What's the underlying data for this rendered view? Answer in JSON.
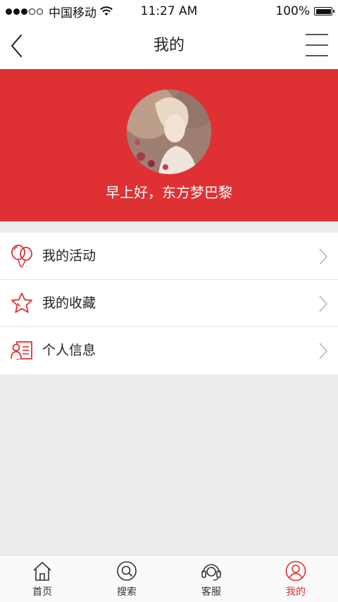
{
  "status_bar": {
    "carrier": "中国移动",
    "time": "11:27 AM",
    "battery": "100%"
  },
  "nav": {
    "title": "我的"
  },
  "profile": {
    "greeting": "早上好，东方梦巴黎"
  },
  "menu": {
    "items": [
      {
        "label": "我的活动",
        "icon": "balloon-icon"
      },
      {
        "label": "我的收藏",
        "icon": "star-icon"
      },
      {
        "label": "个人信息",
        "icon": "id-card-icon"
      }
    ]
  },
  "tabs": [
    {
      "label": "首页",
      "icon": "home-icon"
    },
    {
      "label": "搜索",
      "icon": "search-icon"
    },
    {
      "label": "客服",
      "icon": "headset-icon"
    },
    {
      "label": "我的",
      "icon": "user-icon",
      "active": true
    }
  ],
  "colors": {
    "accent": "#df3134",
    "background": "#ececec"
  }
}
